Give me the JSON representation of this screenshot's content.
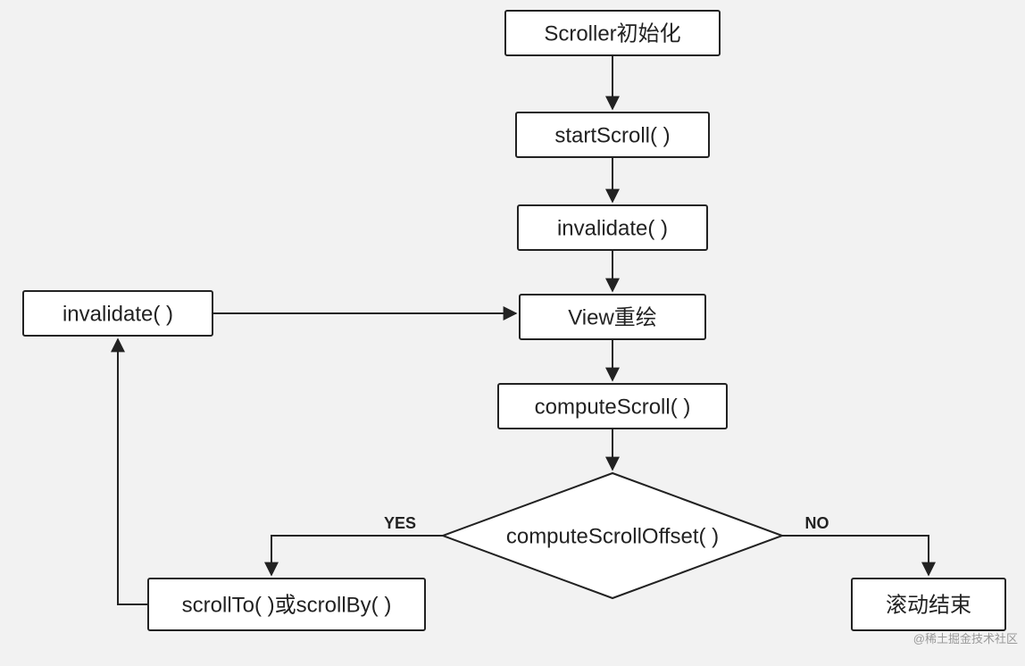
{
  "diagram": {
    "nodes": {
      "init": {
        "label": "Scroller初始化"
      },
      "startScroll": {
        "label": "startScroll( )"
      },
      "invalidate1": {
        "label": "invalidate( )"
      },
      "viewRedraw": {
        "label": "View重绘"
      },
      "computeScroll": {
        "label": "computeScroll( )"
      },
      "decision": {
        "label": "computeScrollOffset( )"
      },
      "scrollToBy": {
        "label": "scrollTo( )或scrollBy( )"
      },
      "invalidate2": {
        "label": "invalidate( )"
      },
      "end": {
        "label": "滚动结束"
      }
    },
    "edge_labels": {
      "yes": "YES",
      "no": "NO"
    },
    "watermark": "@稀土掘金技术社区"
  }
}
